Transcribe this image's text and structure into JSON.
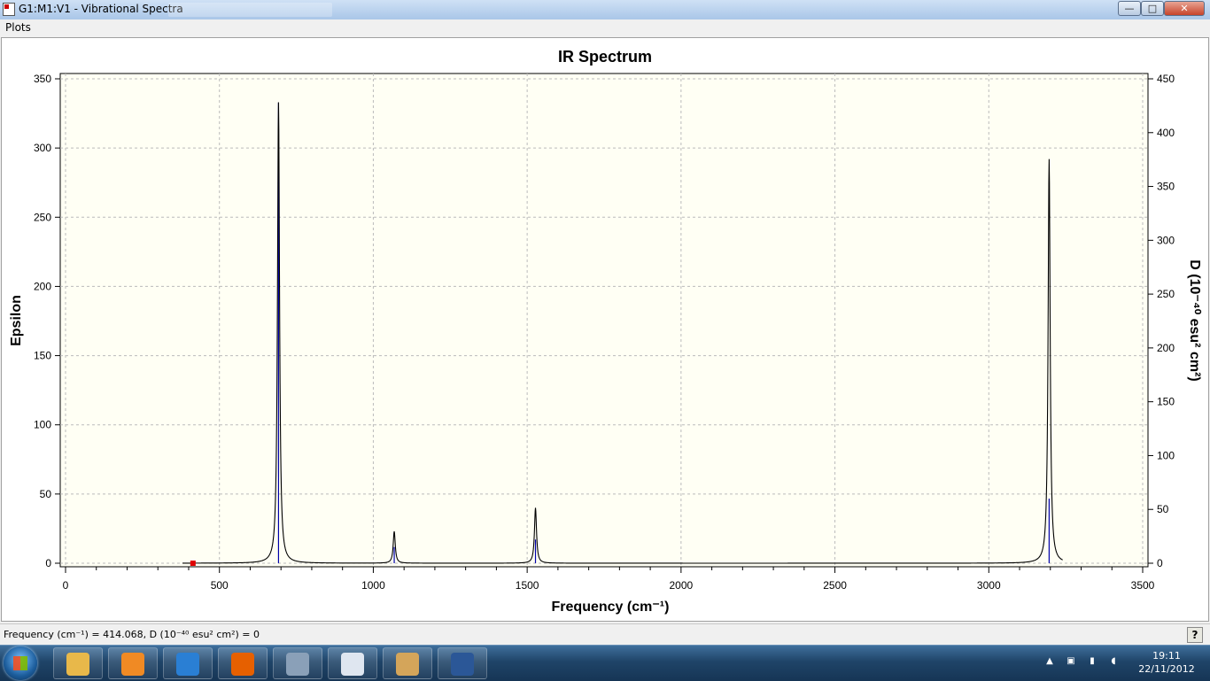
{
  "window": {
    "title": "G1:M1:V1 - Vibrational Spectra",
    "buttons": {
      "minimize": "—",
      "maximize": "□",
      "close": "✕"
    }
  },
  "menu": {
    "items": [
      {
        "label": "Plots"
      }
    ]
  },
  "chart_data": {
    "type": "line",
    "title": "IR Spectrum",
    "xlabel": "Frequency (cm⁻¹)",
    "ylabel_left": "Epsilon",
    "ylabel_right": "D (10⁻⁴⁰ esu² cm²)",
    "xlim": [
      0,
      3500
    ],
    "ylim_left": [
      0,
      350
    ],
    "ylim_right": [
      0,
      450
    ],
    "x_ticks": [
      "0",
      "500",
      "1000",
      "1500",
      "2000",
      "2500",
      "3000",
      "3500"
    ],
    "y_left_ticks": [
      "0",
      "50",
      "100",
      "150",
      "200",
      "250",
      "300",
      "350"
    ],
    "y_right_ticks": [
      "0",
      "50",
      "100",
      "150",
      "200",
      "250",
      "300",
      "350",
      "400",
      "450"
    ],
    "grid": true,
    "background": "#fffff4",
    "curve_color": "#000000",
    "stick_color": "#0000aa",
    "peaks": [
      {
        "x": 692,
        "epsilon": 333,
        "D": 428
      },
      {
        "x": 1068,
        "epsilon": 23,
        "D": 15
      },
      {
        "x": 1527,
        "epsilon": 40,
        "D": 22
      },
      {
        "x": 3196,
        "epsilon": 292,
        "D": 60
      }
    ],
    "cursor_marker": {
      "x": 414,
      "epsilon": 0,
      "color": "#e00000"
    }
  },
  "status": {
    "text": "Frequency (cm⁻¹) = 414.068, D (10⁻⁴⁰ esu² cm²) = 0",
    "help_label": "?"
  },
  "taskbar": {
    "items": [
      {
        "name": "explorer",
        "color": "#e8b84a"
      },
      {
        "name": "media-player",
        "color": "#f08a24"
      },
      {
        "name": "internet-explorer",
        "color": "#2a7fd4"
      },
      {
        "name": "firefox",
        "color": "#e66000"
      },
      {
        "name": "search-tool",
        "color": "#8aa0b8"
      },
      {
        "name": "word-doc",
        "color": "#dfe6f0"
      },
      {
        "name": "paint",
        "color": "#d4a55a"
      },
      {
        "name": "word",
        "color": "#2b5797"
      }
    ],
    "time": "19:11",
    "date": "22/11/2012"
  }
}
